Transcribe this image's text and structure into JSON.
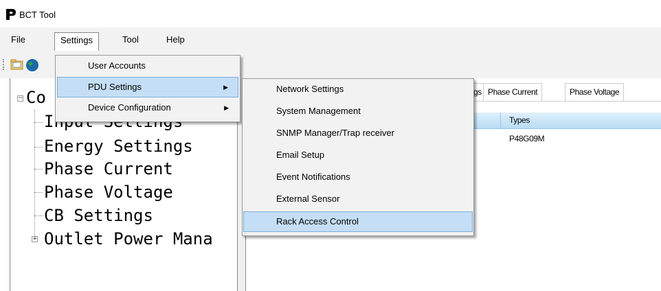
{
  "window": {
    "title": "BCT Tool"
  },
  "menubar": {
    "items": [
      {
        "label": "File"
      },
      {
        "label": "Settings"
      },
      {
        "label": "Tool"
      },
      {
        "label": "Help"
      }
    ]
  },
  "settings_menu": {
    "items": [
      {
        "label": "User Accounts",
        "has_submenu": false
      },
      {
        "label": "PDU Settings",
        "has_submenu": true
      },
      {
        "label": "Device Configuration",
        "has_submenu": true
      }
    ]
  },
  "pdu_submenu": {
    "items": [
      {
        "label": "Network Settings"
      },
      {
        "label": "System Management"
      },
      {
        "label": "SNMP Manager/Trap receiver"
      },
      {
        "label": "Email Setup"
      },
      {
        "label": "Event Notifications"
      },
      {
        "label": "External Sensor"
      },
      {
        "label": "Rack Access Control"
      }
    ]
  },
  "tree": {
    "root_partial": "Co",
    "items": [
      "Input Settings",
      "Energy Settings",
      "Phase Current",
      "Phase Voltage",
      "CB Settings",
      "Outlet Power Mana"
    ]
  },
  "tabs": [
    {
      "label": "gs"
    },
    {
      "label": "Phase Current"
    },
    {
      "label": "Phase Voltage"
    }
  ],
  "grid": {
    "columns": [
      "Types"
    ],
    "rows": [
      [
        "P48G09M"
      ]
    ]
  },
  "colors": {
    "menu_bg": "#f2f2f2",
    "highlight": "#c4def5",
    "highlight_border": "#7aaedc",
    "grid_header": "#b9dcf5"
  }
}
